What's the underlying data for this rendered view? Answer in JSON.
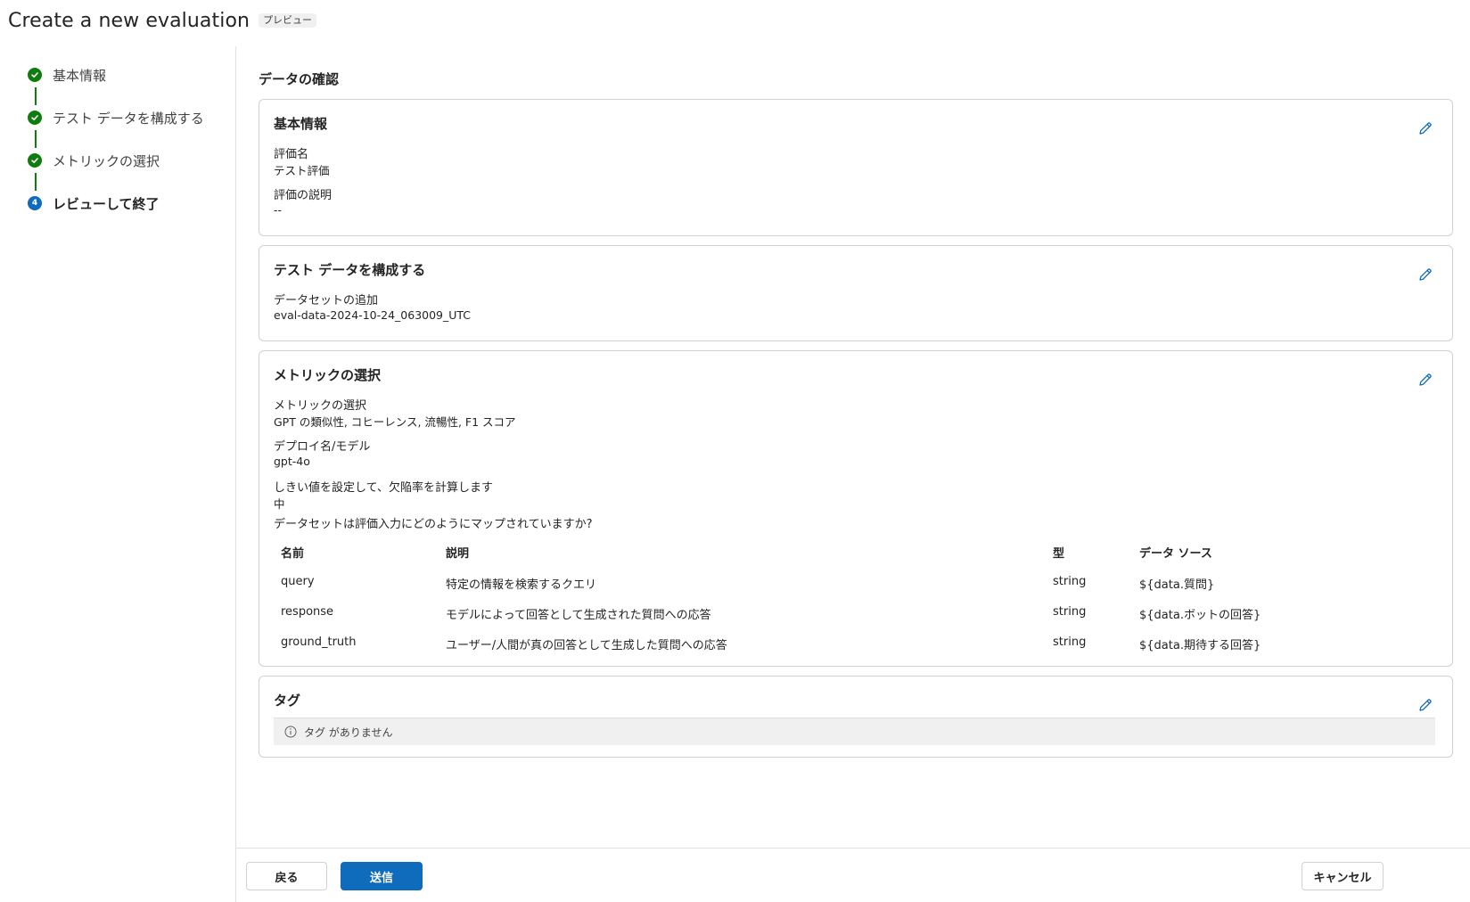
{
  "header": {
    "title": "Create a new evaluation",
    "badge": "プレビュー"
  },
  "wizard": {
    "steps": [
      {
        "label": "基本情報",
        "status": "complete"
      },
      {
        "label": "テスト データを構成する",
        "status": "complete"
      },
      {
        "label": "メトリックの選択",
        "status": "complete"
      },
      {
        "label": "レビューして終了",
        "status": "current",
        "number": "4"
      }
    ]
  },
  "review": {
    "heading": "データの確認",
    "basic": {
      "title": "基本情報",
      "name_label": "評価名",
      "name_value": "テスト評価",
      "desc_label": "評価の説明",
      "desc_value": "--"
    },
    "test_data": {
      "title": "テスト データを構成する",
      "dataset_label": "データセットの追加",
      "dataset_value": "eval-data-2024-10-24_063009_UTC"
    },
    "metrics": {
      "title": "メトリックの選択",
      "metric_label": "メトリックの選択",
      "metric_value": "GPT の類似性, コヒーレンス, 流暢性, F1 スコア",
      "deploy_label": "デプロイ名/モデル",
      "deploy_value": "gpt-4o",
      "threshold_label": "しきい値を設定して、欠陥率を計算します",
      "threshold_value": "中",
      "mapping_question": "データセットは評価入力にどのようにマップされていますか?",
      "columns": [
        "名前",
        "説明",
        "型",
        "データ ソース"
      ],
      "rows": [
        {
          "name": "query",
          "description": "特定の情報を検索するクエリ",
          "type": "string",
          "source": "${data.質問}"
        },
        {
          "name": "response",
          "description": "モデルによって回答として生成された質問への応答",
          "type": "string",
          "source": "${data.ボットの回答}"
        },
        {
          "name": "ground_truth",
          "description": "ユーザー/人間が真の回答として生成した質問への応答",
          "type": "string",
          "source": "${data.期待する回答}"
        }
      ]
    },
    "tags": {
      "title": "タグ",
      "empty_text": "タグ がありません"
    }
  },
  "footer": {
    "back_label": "戻る",
    "submit_label": "送信",
    "cancel_label": "キャンセル"
  },
  "colors": {
    "accent": "#0f6cbd",
    "success": "#107c10",
    "border": "#d1d1d1"
  }
}
